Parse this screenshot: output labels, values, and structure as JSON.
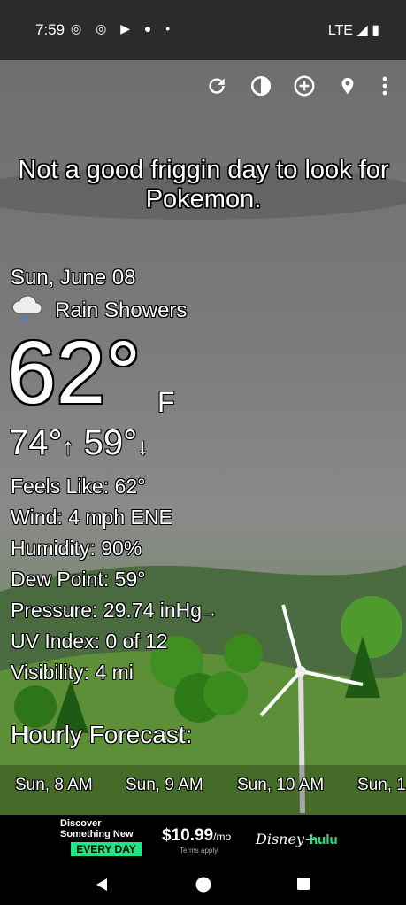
{
  "status_bar": {
    "time": "7:59",
    "icons": [
      "instagram-icon",
      "instagram-icon",
      "youtube-icon",
      "circle-icon",
      "dot-icon"
    ],
    "network": "LTE"
  },
  "toolbar": {
    "icons": [
      "refresh-icon",
      "theme-icon",
      "add-location-icon",
      "location-pin-icon",
      "more-vert-icon"
    ]
  },
  "headline": "Not a good friggin day to look for Pokemon.",
  "current": {
    "date": "Sun, June 08",
    "condition": "Rain Showers",
    "condition_icon": "rain-cloud-icon",
    "temperature": "62°",
    "unit": "F",
    "high": "74°",
    "low": "59°"
  },
  "details": [
    {
      "label": "Feels Like:",
      "value": "62°"
    },
    {
      "label": "Wind:",
      "value": "4 mph ENE"
    },
    {
      "label": "Humidity:",
      "value": "90%"
    },
    {
      "label": "Dew Point:",
      "value": "59°"
    },
    {
      "label": "Pressure:",
      "value": "29.74 inHg"
    },
    {
      "label": "UV Index:",
      "value": "0 of 12"
    },
    {
      "label": "Visibility:",
      "value": "4 mi"
    }
  ],
  "hourly": {
    "title": "Hourly Forecast:",
    "hours": [
      "Sun, 8 AM",
      "Sun, 9 AM",
      "Sun, 10 AM",
      "Sun, 1"
    ]
  },
  "ad": {
    "line1": "Discover",
    "line2": "Something New",
    "badge": "EVERY DAY",
    "price": "$10.99",
    "per": "/mo",
    "terms": "Terms apply.",
    "brand1": "Disney+",
    "brand2": "hulu"
  },
  "colors": {
    "status_bar": "#2b2b2b",
    "ad_badge": "#1ce783",
    "hulu": "#1ce783"
  }
}
